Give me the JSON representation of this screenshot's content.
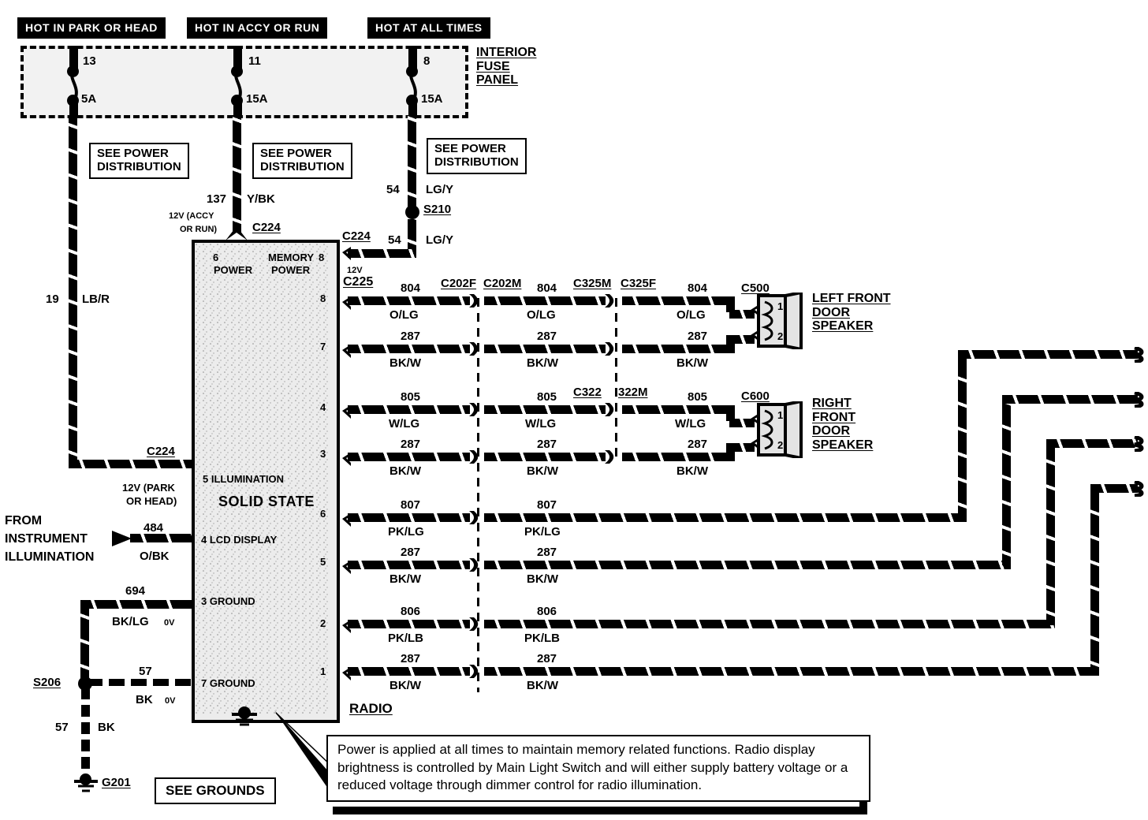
{
  "diagram": {
    "title": "RADIO",
    "headers": [
      {
        "label": "HOT IN PARK OR HEAD"
      },
      {
        "label": "HOT IN ACCY OR RUN"
      },
      {
        "label": "HOT AT ALL TIMES"
      }
    ],
    "fuse_panel": {
      "name_lines": [
        "INTERIOR",
        "FUSE",
        "PANEL"
      ],
      "fuses": [
        {
          "number": "13",
          "rating": "5A"
        },
        {
          "number": "11",
          "rating": "15A"
        },
        {
          "number": "8",
          "rating": "15A"
        }
      ]
    },
    "see_power_distribution": [
      "SEE POWER",
      "DISTRIBUTION"
    ],
    "see_grounds": "SEE GROUNDS",
    "left_branch": {
      "circuit": "19",
      "color": "LB/R",
      "connector": "C224",
      "voltage_lines": [
        "12V (PARK",
        "OR HEAD)"
      ]
    },
    "mid_branch": {
      "circuit": "137",
      "color": "Y/BK",
      "connector": "C224",
      "voltage_lines": [
        "12V (ACCY",
        "OR RUN)"
      ]
    },
    "right_branch": {
      "circuit_top": "54",
      "color_top": "LG/Y",
      "splice": "S210",
      "circuit_bottom": "54",
      "color_bottom": "LG/Y",
      "connector": "C224",
      "voltage": "12V"
    },
    "radio": {
      "label": "RADIO",
      "type": "SOLID STATE",
      "left_pins": [
        {
          "pin": "6",
          "name": "POWER"
        },
        {
          "pin": "5",
          "name": "ILLUMINATION"
        },
        {
          "pin": "4",
          "name": "LCD DISPLAY"
        },
        {
          "pin": "3",
          "name": "GROUND"
        },
        {
          "pin": "7",
          "name": "GROUND"
        }
      ],
      "memory_power": {
        "name_lines": [
          "MEMORY",
          "POWER"
        ],
        "pin": "8"
      },
      "right_pins": [
        "8",
        "7",
        "4",
        "3",
        "6",
        "5",
        "2",
        "1"
      ]
    },
    "illumination_source": [
      "FROM",
      "INSTRUMENT",
      "ILLUMINATION"
    ],
    "illum_circuits": [
      {
        "circuit": "484",
        "color": "O/BK"
      },
      {
        "circuit": "694",
        "color": "BK/LG",
        "voltage": "0V"
      },
      {
        "circuit": "57",
        "color": "BK",
        "voltage": "0V"
      }
    ],
    "ground": {
      "splice": "S206",
      "circuit": "57",
      "color": "BK",
      "ground_id": "G201"
    },
    "harness_connector_label": "C225",
    "connector_pairs": [
      {
        "left": "C202F",
        "right": "C202M"
      },
      {
        "left": "C325M",
        "right": "C325F"
      },
      {
        "left": "C322",
        "right": "322M"
      }
    ],
    "speakers": [
      {
        "connector": "C500",
        "name_lines": [
          "LEFT FRONT",
          "DOOR",
          "SPEAKER"
        ],
        "terminals": [
          "1",
          "2"
        ]
      },
      {
        "connector": "C600",
        "name_lines": [
          "RIGHT",
          "FRONT",
          "DOOR",
          "SPEAKER"
        ],
        "terminals": [
          "1",
          "2"
        ]
      }
    ],
    "wire_rows": [
      {
        "pin": "8",
        "circuit": "804",
        "color": "O/LG",
        "seg2_circuit": "804",
        "seg2_color": "O/LG",
        "seg3_circuit": "804",
        "seg3_color": "O/LG"
      },
      {
        "pin": "7",
        "circuit": "287",
        "color": "BK/W",
        "seg2_circuit": "287",
        "seg2_color": "BK/W",
        "seg3_circuit": "287",
        "seg3_color": "BK/W"
      },
      {
        "pin": "4",
        "circuit": "805",
        "color": "W/LG",
        "seg2_circuit": "805",
        "seg2_color": "W/LG",
        "seg3_circuit": "805",
        "seg3_color": "W/LG"
      },
      {
        "pin": "3",
        "circuit": "287",
        "color": "BK/W",
        "seg2_circuit": "287",
        "seg2_color": "BK/W",
        "seg3_circuit": "287",
        "seg3_color": "BK/W"
      },
      {
        "pin": "6",
        "circuit": "807",
        "color": "PK/LG",
        "seg2_circuit": "807",
        "seg2_color": "PK/LG"
      },
      {
        "pin": "5",
        "circuit": "287",
        "color": "BK/W",
        "seg2_circuit": "287",
        "seg2_color": "BK/W"
      },
      {
        "pin": "2",
        "circuit": "806",
        "color": "PK/LB",
        "seg2_circuit": "806",
        "seg2_color": "PK/LB"
      },
      {
        "pin": "1",
        "circuit": "287",
        "color": "BK/W",
        "seg2_circuit": "287",
        "seg2_color": "BK/W"
      }
    ],
    "note": "Power is applied at all times to maintain memory related functions.  Radio display brightness is controlled by Main Light Switch and will either supply battery voltage or a reduced voltage through dimmer control for radio illumination."
  }
}
